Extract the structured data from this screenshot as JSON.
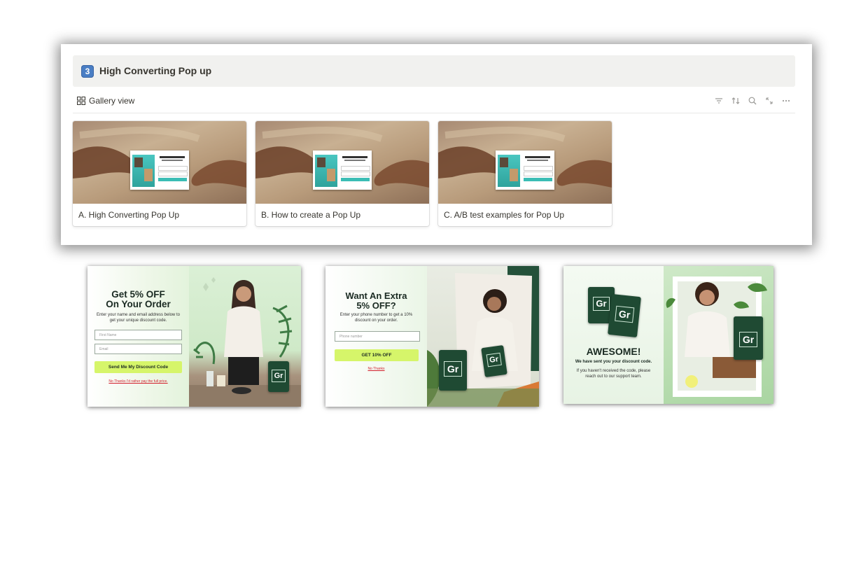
{
  "database": {
    "number_badge": "3",
    "title": "High Converting Pop up"
  },
  "view": {
    "label": "Gallery view",
    "toolbar_icons": [
      "filter-icon",
      "sort-icon",
      "search-icon",
      "expand-icon",
      "more-icon"
    ]
  },
  "cards": [
    {
      "label": "A. High Converting Pop Up"
    },
    {
      "label": "B. How to create a Pop Up"
    },
    {
      "label": "C. A/B test examples for Pop Up"
    }
  ],
  "popup1": {
    "headline_line1": "Get 5% OFF",
    "headline_line2": "On Your Order",
    "subtext": "Enter your name and email address below to get your unique discount code.",
    "first_name_placeholder": "First Name",
    "email_placeholder": "Email",
    "cta": "Send Me My Discount Code",
    "decline": "No Thanks I'd rather pay the full price."
  },
  "popup2": {
    "headline_line1": "Want An Extra",
    "headline_line2": "5% OFF?",
    "subtext": "Enter your phone number to get a 10% discount on your order.",
    "phone_placeholder": "Phone number",
    "cta": "GET 10% OFF",
    "decline": "No Thanks"
  },
  "popup3": {
    "headline": "AWESOME!",
    "subheadline": "We have sent you your discount code.",
    "body": "If you haven't received the code, please reach out to our support team."
  },
  "product_mark": "Gr",
  "colors": {
    "accent_button": "#d6f56a",
    "brand_green": "#1f4a33",
    "decline_red": "#d21f2c"
  }
}
